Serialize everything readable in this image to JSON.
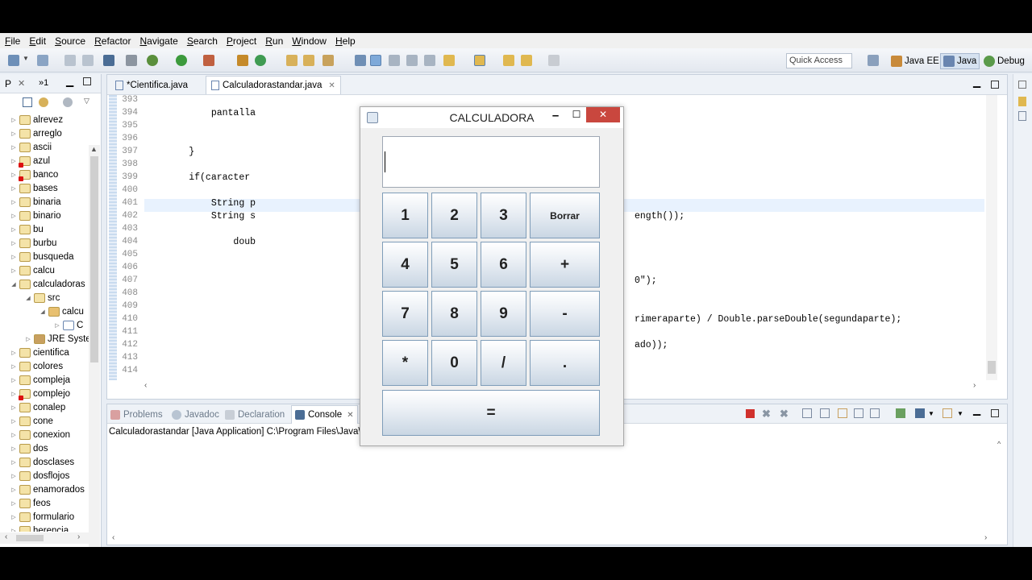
{
  "menu": [
    "File",
    "Edit",
    "Source",
    "Refactor",
    "Navigate",
    "Search",
    "Project",
    "Run",
    "Window",
    "Help"
  ],
  "toolbar": {
    "quick_access": "Quick Access",
    "perspectives": [
      "Java EE",
      "Java",
      "Debug"
    ]
  },
  "package_explorer": {
    "tabs": [
      "P",
      "»1"
    ],
    "items": [
      {
        "label": "alrevez",
        "level": 0,
        "expanded": false,
        "error": false
      },
      {
        "label": "arreglo",
        "level": 0,
        "expanded": false,
        "error": false
      },
      {
        "label": "ascii",
        "level": 0,
        "expanded": false,
        "error": false
      },
      {
        "label": "azul",
        "level": 0,
        "expanded": false,
        "error": true
      },
      {
        "label": "banco",
        "level": 0,
        "expanded": false,
        "error": true
      },
      {
        "label": "bases",
        "level": 0,
        "expanded": false,
        "error": false
      },
      {
        "label": "binaria",
        "level": 0,
        "expanded": false,
        "error": false
      },
      {
        "label": "binario",
        "level": 0,
        "expanded": false,
        "error": false
      },
      {
        "label": "bu",
        "level": 0,
        "expanded": false,
        "error": false
      },
      {
        "label": "burbu",
        "level": 0,
        "expanded": false,
        "error": false
      },
      {
        "label": "busqueda",
        "level": 0,
        "expanded": false,
        "error": false
      },
      {
        "label": "calcu",
        "level": 0,
        "expanded": false,
        "error": false
      },
      {
        "label": "calculadoras",
        "level": 0,
        "expanded": true,
        "error": false
      },
      {
        "label": "src",
        "level": 1,
        "expanded": true,
        "error": false
      },
      {
        "label": "calcu",
        "level": 2,
        "expanded": true,
        "error": false
      },
      {
        "label": "C",
        "level": 3,
        "expanded": false,
        "error": false
      },
      {
        "label": "JRE Syste",
        "level": 1,
        "expanded": false,
        "error": false
      },
      {
        "label": "cientifica",
        "level": 0,
        "expanded": false,
        "error": false
      },
      {
        "label": "colores",
        "level": 0,
        "expanded": false,
        "error": false
      },
      {
        "label": "compleja",
        "level": 0,
        "expanded": false,
        "error": false
      },
      {
        "label": "complejo",
        "level": 0,
        "expanded": false,
        "error": true
      },
      {
        "label": "conalep",
        "level": 0,
        "expanded": false,
        "error": false
      },
      {
        "label": "cone",
        "level": 0,
        "expanded": false,
        "error": false
      },
      {
        "label": "conexion",
        "level": 0,
        "expanded": false,
        "error": false
      },
      {
        "label": "dos",
        "level": 0,
        "expanded": false,
        "error": false
      },
      {
        "label": "dosclases",
        "level": 0,
        "expanded": false,
        "error": false
      },
      {
        "label": "dosflojos",
        "level": 0,
        "expanded": false,
        "error": false
      },
      {
        "label": "enamorados",
        "level": 0,
        "expanded": false,
        "error": false
      },
      {
        "label": "feos",
        "level": 0,
        "expanded": false,
        "error": false
      },
      {
        "label": "formulario",
        "level": 0,
        "expanded": false,
        "error": false
      },
      {
        "label": "herencia",
        "level": 0,
        "expanded": false,
        "error": false
      }
    ]
  },
  "editor": {
    "tabs": [
      {
        "label": "*Cientifica.java",
        "active": false
      },
      {
        "label": "Calculadorastandar.java",
        "active": true
      }
    ],
    "lines": [
      {
        "num": "393",
        "text": ""
      },
      {
        "num": "394",
        "text": "            pantalla"
      },
      {
        "num": "395",
        "text": ""
      },
      {
        "num": "396",
        "text": ""
      },
      {
        "num": "397",
        "text": "        }"
      },
      {
        "num": "398",
        "text": ""
      },
      {
        "num": "399",
        "text": "        if(caracter"
      },
      {
        "num": "400",
        "text": ""
      },
      {
        "num": "401",
        "text": "            String p"
      },
      {
        "num": "402",
        "text": "            String s"
      },
      {
        "num": "403",
        "text": ""
      },
      {
        "num": "404",
        "text": "                doub"
      },
      {
        "num": "405",
        "text": ""
      },
      {
        "num": "406",
        "text": ""
      },
      {
        "num": "407",
        "text": ""
      },
      {
        "num": "408",
        "text": ""
      },
      {
        "num": "409",
        "text": ""
      },
      {
        "num": "410",
        "text": ""
      },
      {
        "num": "411",
        "text": ""
      },
      {
        "num": "412",
        "text": ""
      },
      {
        "num": "413",
        "text": ""
      },
      {
        "num": "414",
        "text": ""
      }
    ],
    "right_fragments": [
      {
        "line": "402",
        "text": "ength());"
      },
      {
        "line": "407",
        "text": "0\");"
      },
      {
        "line": "410",
        "text": "rimeraparte) / Double.parseDouble(segundaparte);"
      },
      {
        "line": "412",
        "text": "ado));"
      }
    ]
  },
  "console": {
    "tabs": [
      {
        "label": "Problems",
        "active": false
      },
      {
        "label": "Javadoc",
        "active": false
      },
      {
        "label": "Declaration",
        "active": false
      },
      {
        "label": "Console",
        "active": true
      }
    ],
    "title": "Calculadorastandar [Java Application] C:\\Program Files\\Java\\jre"
  },
  "calculator": {
    "title": "CALCULADORA",
    "display_value": "",
    "buttons": [
      [
        "1",
        "2",
        "3",
        "Borrar"
      ],
      [
        "4",
        "5",
        "6",
        "+"
      ],
      [
        "7",
        "8",
        "9",
        "-"
      ],
      [
        "*",
        "0",
        "/",
        "."
      ]
    ],
    "equals": "="
  }
}
